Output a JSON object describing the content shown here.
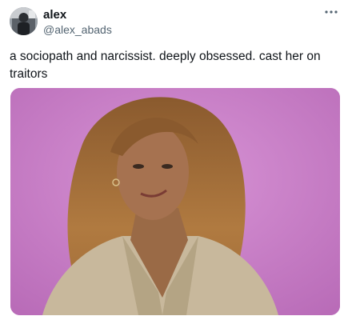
{
  "tweet": {
    "author": {
      "name": "alex",
      "handle": "@alex_abads"
    },
    "text": "a sociopath and narcissist. deeply obsessed. cast her on traitors",
    "icons": {
      "more": "more-options-icon"
    },
    "media": {
      "kind": "photo",
      "background_color": "#cf84cf"
    }
  }
}
